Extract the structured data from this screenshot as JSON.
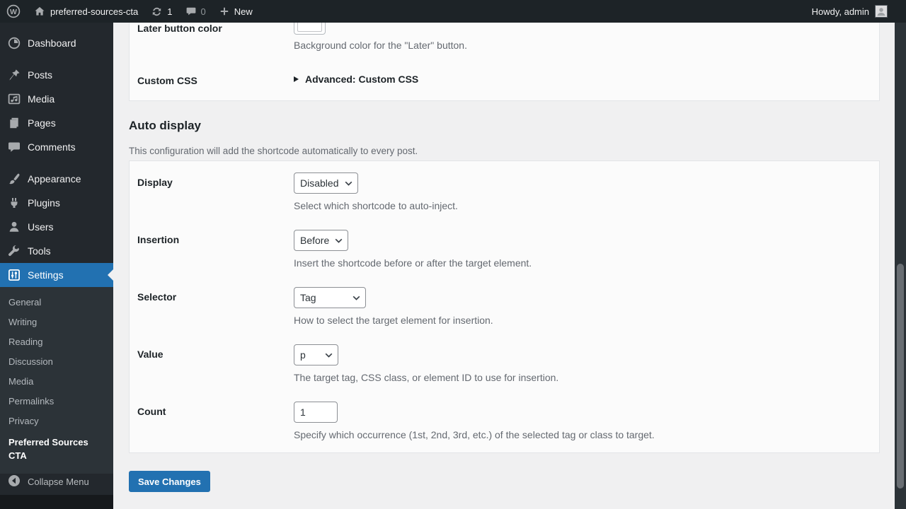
{
  "colors": {
    "accent": "#2271b1",
    "admin_bar_bg": "#1d2327",
    "menu_bg": "#23282d",
    "submenu_bg": "#2c3338",
    "content_bg": "#f0f0f1",
    "card_bg": "#fbfbfb",
    "label_text": "#1d2327",
    "muted_text": "#646970"
  },
  "icons": {
    "wp-logo": "W in circle",
    "home": "house glyph",
    "updates": "circular refresh arrows",
    "comments": "speech bubble",
    "new": "plus sign",
    "avatar": "person silhouette",
    "select-chevron": "chevron down",
    "details-marker": "triangle right",
    "collapse": "left arrow in circle"
  },
  "admin_bar": {
    "wp_logo_letter": "W",
    "site_name": "preferred-sources-cta",
    "updates_count": "1",
    "comments_count": "0",
    "new_label": "New",
    "howdy_label": "Howdy, admin"
  },
  "sidebar": {
    "items": [
      {
        "label": "Dashboard"
      },
      {
        "label": "Posts"
      },
      {
        "label": "Media"
      },
      {
        "label": "Pages"
      },
      {
        "label": "Comments"
      },
      {
        "label": "Appearance"
      },
      {
        "label": "Plugins"
      },
      {
        "label": "Users"
      },
      {
        "label": "Tools"
      },
      {
        "label": "Settings"
      }
    ],
    "settings_submenu": [
      {
        "label": "General"
      },
      {
        "label": "Writing"
      },
      {
        "label": "Reading"
      },
      {
        "label": "Discussion"
      },
      {
        "label": "Media"
      },
      {
        "label": "Permalinks"
      },
      {
        "label": "Privacy"
      },
      {
        "label": "Preferred Sources CTA"
      }
    ],
    "collapse_label": "Collapse Menu"
  },
  "settings_form": {
    "later_button_color": {
      "label": "Later button color",
      "description": "Background color for the \"Later\" button."
    },
    "custom_css": {
      "label": "Custom CSS",
      "summary": "Advanced: Custom CSS"
    },
    "auto_display": {
      "title": "Auto display",
      "description": "This configuration will add the shortcode automatically to every post.",
      "fields": [
        {
          "label": "Display",
          "value": "Disabled",
          "description": "Select which shortcode to auto-inject."
        },
        {
          "label": "Insertion",
          "value": "Before",
          "description": "Insert the shortcode before or after the target element."
        },
        {
          "label": "Selector",
          "value": "Tag",
          "description": "How to select the target element for insertion."
        },
        {
          "label": "Value",
          "value": "p",
          "description": "The target tag, CSS class, or element ID to use for insertion."
        },
        {
          "label": "Count",
          "value": "1",
          "description": "Specify which occurrence (1st, 2nd, 3rd, etc.) of the selected tag or class to target."
        }
      ]
    },
    "save_label": "Save Changes"
  }
}
